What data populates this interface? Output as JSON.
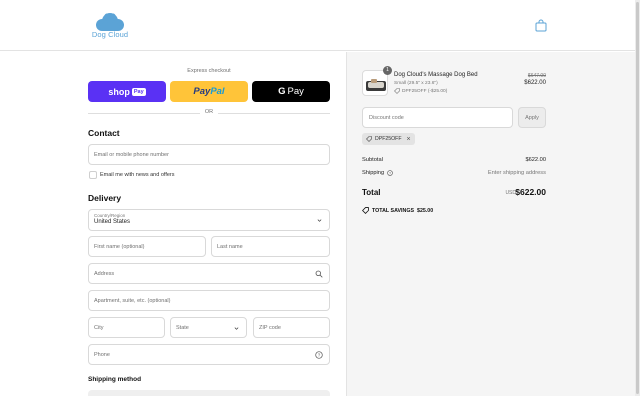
{
  "brand": {
    "name": "Dog Cloud",
    "color": "#5ba3d6"
  },
  "express": {
    "label": "Express checkout",
    "shop_pay": {
      "shop": "shop",
      "pay": "Pay"
    },
    "paypal": {
      "part1": "Pay",
      "part2": "Pal"
    },
    "gpay": {
      "g": "G",
      "pay": "Pay"
    },
    "or": "OR"
  },
  "contact": {
    "title": "Contact",
    "email_placeholder": "Email or mobile phone number",
    "newsletter_label": "Email me with news and offers"
  },
  "delivery": {
    "title": "Delivery",
    "country_label": "Country/Region",
    "country_value": "United States",
    "first_name": "First name (optional)",
    "last_name": "Last name",
    "address": "Address",
    "apartment": "Apartment, suite, etc. (optional)",
    "city": "City",
    "state": "State",
    "zip": "ZIP code",
    "phone": "Phone"
  },
  "shipping_method": {
    "title": "Shipping method"
  },
  "order": {
    "item": {
      "quantity": "1",
      "name": "Dog Cloud's Massage Dog Bed",
      "variant": "Small (29.5\" x 23.6\")",
      "discount": "DPF25OFF (-$25.00)",
      "price_original": "$647.00",
      "price_final": "$622.00"
    },
    "discount_placeholder": "Discount code",
    "apply_label": "Apply",
    "applied_code": "DPF25OFF",
    "subtotal_label": "Subtotal",
    "subtotal_value": "$622.00",
    "shipping_label": "Shipping",
    "shipping_value": "Enter shipping address",
    "total_label": "Total",
    "currency": "USD",
    "total_value": "$622.00",
    "savings_label": "TOTAL SAVINGS",
    "savings_value": "$25.00"
  },
  "colors": {
    "shop_pay": "#5a31f4",
    "paypal": "#ffc439",
    "gpay": "#000000"
  }
}
